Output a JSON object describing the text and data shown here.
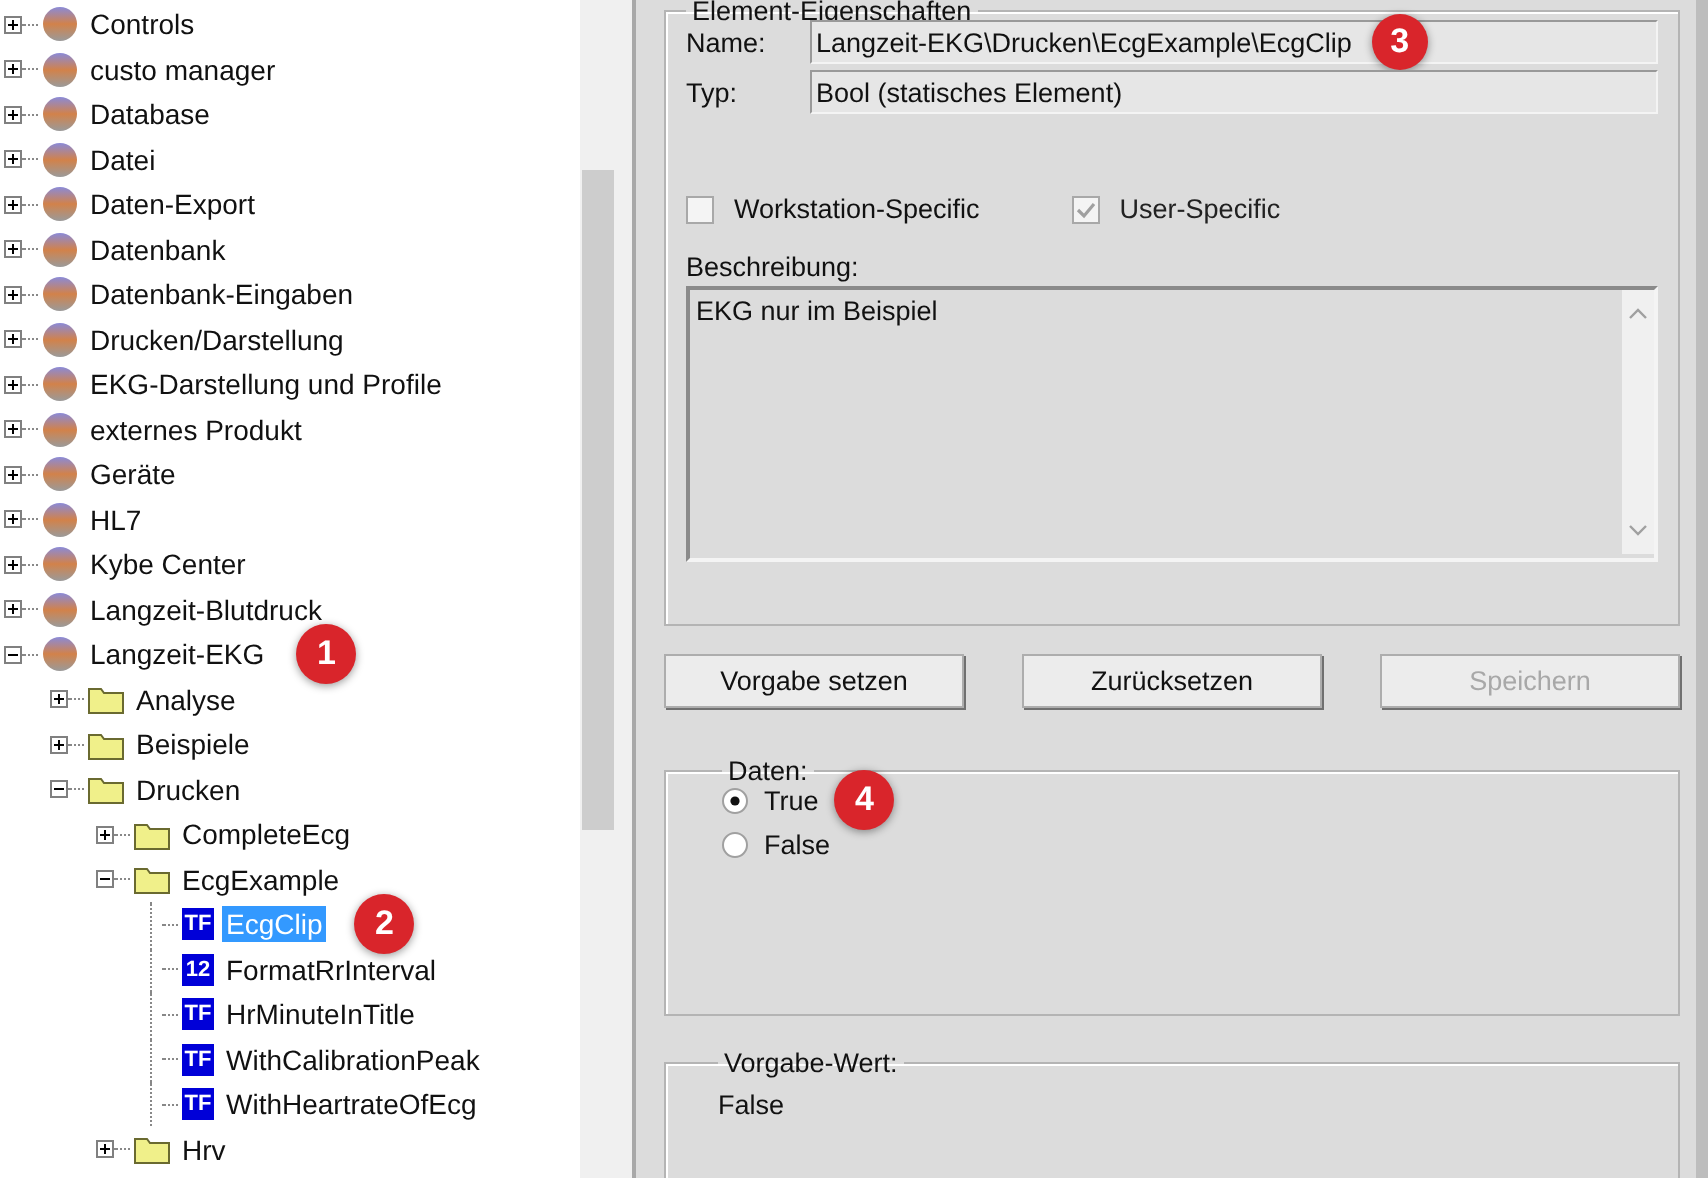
{
  "tree": {
    "items": [
      {
        "label": "Controls",
        "kind": "globe",
        "expanded": false,
        "selected": false
      },
      {
        "label": "custo manager",
        "kind": "globe",
        "expanded": false,
        "selected": false
      },
      {
        "label": "Database",
        "kind": "globe",
        "expanded": false,
        "selected": false
      },
      {
        "label": "Datei",
        "kind": "globe",
        "expanded": false,
        "selected": false
      },
      {
        "label": "Daten-Export",
        "kind": "globe",
        "expanded": false,
        "selected": false
      },
      {
        "label": "Datenbank",
        "kind": "globe",
        "expanded": false,
        "selected": false
      },
      {
        "label": "Datenbank-Eingaben",
        "kind": "globe",
        "expanded": false,
        "selected": false
      },
      {
        "label": "Drucken/Darstellung",
        "kind": "globe",
        "expanded": false,
        "selected": false
      },
      {
        "label": "EKG-Darstellung und Profile",
        "kind": "globe",
        "expanded": false,
        "selected": false
      },
      {
        "label": "externes Produkt",
        "kind": "globe",
        "expanded": false,
        "selected": false
      },
      {
        "label": "Geräte",
        "kind": "globe",
        "expanded": false,
        "selected": false
      },
      {
        "label": "HL7",
        "kind": "globe",
        "expanded": false,
        "selected": false
      },
      {
        "label": "Kybe Center",
        "kind": "globe",
        "expanded": false,
        "selected": false
      },
      {
        "label": "Langzeit-Blutdruck",
        "kind": "globe",
        "expanded": false,
        "selected": false
      },
      {
        "label": "Langzeit-EKG",
        "kind": "globe",
        "expanded": true,
        "selected": false,
        "badge": "1",
        "children": [
          {
            "label": "Analyse",
            "kind": "folder",
            "expanded": false,
            "selected": false
          },
          {
            "label": "Beispiele",
            "kind": "folder",
            "expanded": false,
            "selected": false
          },
          {
            "label": "Drucken",
            "kind": "folder",
            "expanded": true,
            "selected": false,
            "children": [
              {
                "label": "CompleteEcg",
                "kind": "folder",
                "expanded": false,
                "selected": false
              },
              {
                "label": "EcgExample",
                "kind": "folder",
                "expanded": true,
                "selected": false,
                "children": [
                  {
                    "label": "EcgClip",
                    "kind": "value",
                    "icon_text": "TF",
                    "selected": true,
                    "badge": "2"
                  },
                  {
                    "label": "FormatRrInterval",
                    "kind": "value",
                    "icon_text": "12",
                    "selected": false
                  },
                  {
                    "label": "HrMinuteInTitle",
                    "kind": "value",
                    "icon_text": "TF",
                    "selected": false
                  },
                  {
                    "label": "WithCalibrationPeak",
                    "kind": "value",
                    "icon_text": "TF",
                    "selected": false
                  },
                  {
                    "label": "WithHeartrateOfEcg",
                    "kind": "value",
                    "icon_text": "TF",
                    "selected": false
                  }
                ]
              },
              {
                "label": "Hrv",
                "kind": "folder",
                "expanded": false,
                "selected": false
              }
            ]
          }
        ]
      }
    ]
  },
  "properties": {
    "title": "Element-Eigenschaften",
    "fields": [
      {
        "label": "Name:",
        "value": "Langzeit-EKG\\Drucken\\EcgExample\\EcgClip",
        "badge": "3"
      },
      {
        "label": "Typ:",
        "value": "Bool (statisches Element)"
      }
    ],
    "checkboxes": [
      {
        "label": "Workstation-Specific",
        "checked": false,
        "disabled": false
      },
      {
        "label": "User-Specific",
        "checked": true,
        "disabled": true
      }
    ],
    "description": {
      "label": "Beschreibung:",
      "value": "EKG nur im Beispiel"
    }
  },
  "buttons": [
    {
      "label": "Vorgabe setzen",
      "disabled": false
    },
    {
      "label": "Zurücksetzen",
      "disabled": false
    },
    {
      "label": "Speichern",
      "disabled": true
    }
  ],
  "data_group": {
    "title": "Daten:",
    "options": [
      {
        "label": "True",
        "selected": true,
        "badge": "4"
      },
      {
        "label": "False",
        "selected": false
      }
    ]
  },
  "default_group": {
    "title": "Vorgabe-Wert:",
    "value": "False"
  }
}
